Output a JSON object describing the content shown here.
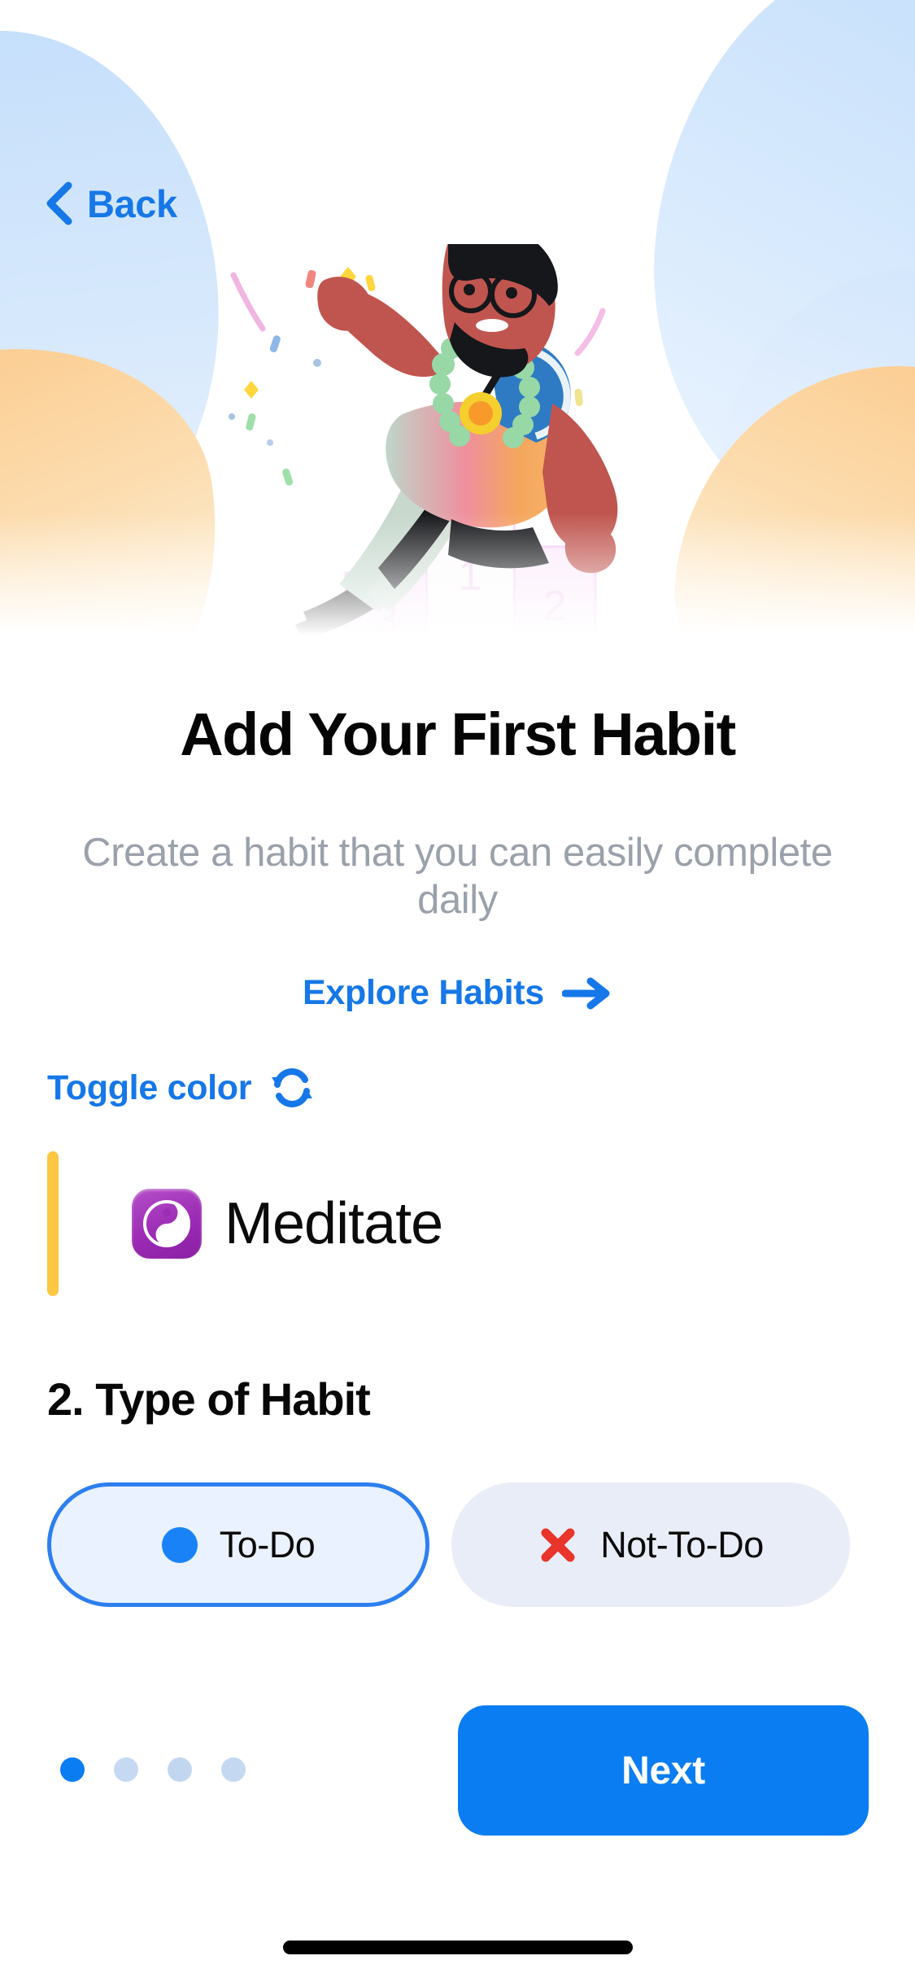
{
  "header": {
    "back_label": "Back",
    "back_icon": "chevron-left-icon",
    "illustration": {
      "name": "winner-on-podium-illustration",
      "podium_labels": [
        "3",
        "1",
        "2"
      ],
      "medal": "gold-medal"
    }
  },
  "main": {
    "title": "Add Your First Habit",
    "subtitle": "Create a habit that you can easily complete daily",
    "explore_link": {
      "label": "Explore Habits",
      "icon": "arrow-right-icon"
    },
    "toggle_color": {
      "label": "Toggle color",
      "icon": "refresh-sync-icon"
    },
    "habit_input": {
      "value": "Meditate",
      "emoji": "☯",
      "emoji_name": "yin-yang-emoji",
      "caret_color": "#fcc843",
      "emoji_tile_color": "#9c2bb5"
    },
    "section_two": {
      "heading": "2. Type of Habit",
      "options": [
        {
          "label": "To-Do",
          "icon": "blue-dot-icon",
          "selected": true
        },
        {
          "label": "Not-To-Do",
          "icon": "red-cross-icon",
          "selected": false
        }
      ]
    }
  },
  "footer": {
    "pagination": {
      "total": 4,
      "active_index": 0
    },
    "next_label": "Next"
  },
  "colors": {
    "accent_blue": "#0b7df2",
    "link_blue": "#1677e8",
    "selected_pill_bg": "#e9f2fe",
    "unselected_pill_bg": "#e9edf7",
    "subtitle_gray": "#9aa1ab",
    "caret_yellow": "#fcc843",
    "red_cross": "#e8342a"
  }
}
